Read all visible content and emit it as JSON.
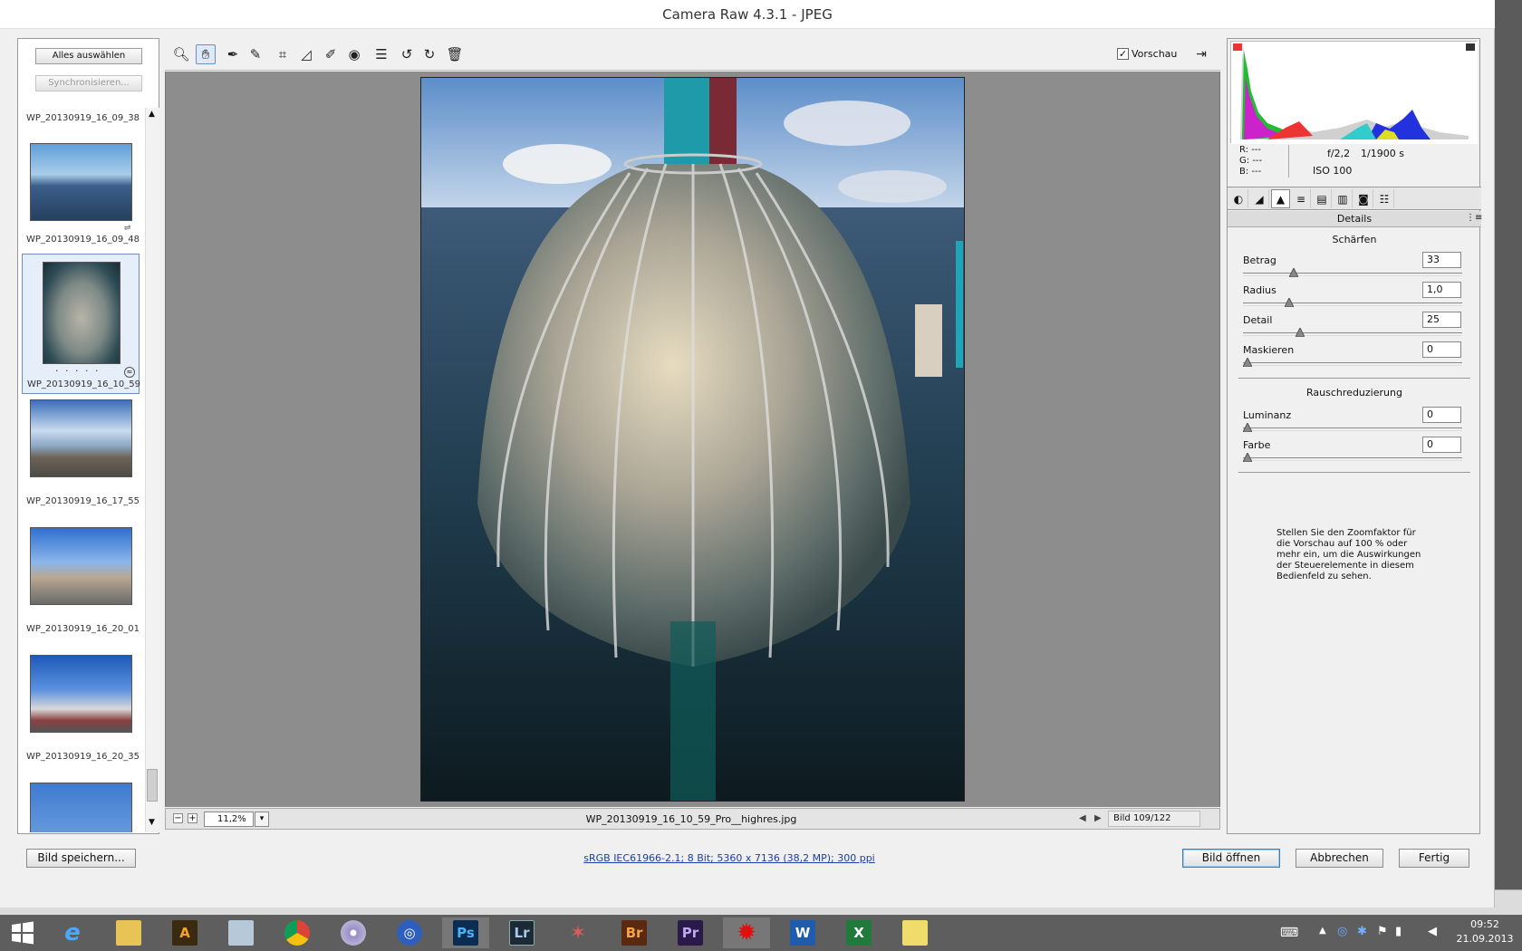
{
  "window": {
    "title": "Camera Raw 4.3.1 - JPEG"
  },
  "filmstrip": {
    "select_all": "Alles auswählen",
    "synchronize": "Synchronisieren...",
    "items": [
      {
        "name": "WP_20130919_16_09_38_..."
      },
      {
        "name": "WP_20130919_16_09_48_..."
      },
      {
        "name": "WP_20130919_16_10_59_...",
        "selected": true
      },
      {
        "name": "WP_20130919_16_17_55_..."
      },
      {
        "name": "WP_20130919_16_20_01_..."
      },
      {
        "name": "WP_20130919_16_20_35_..."
      }
    ],
    "rating_dots": "· · · · ·"
  },
  "toolbar": {
    "tools": [
      "zoom-tool",
      "hand-tool",
      "white-balance-tool",
      "color-sampler-tool",
      "crop-tool",
      "straighten-tool",
      "retouch-tool",
      "red-eye-tool",
      "preferences-tool",
      "rotate-left-tool",
      "rotate-right-tool",
      "delete-tool"
    ],
    "preview_label": "Vorschau",
    "preview_checked": true
  },
  "status": {
    "zoom_minus": "−",
    "zoom_plus": "+",
    "zoom": "11,2%",
    "filename": "WP_20130919_16_10_59_Pro__highres.jpg",
    "image_counter": "Bild 109/122"
  },
  "info": {
    "r_label": "R:",
    "r_value": "---",
    "g_label": "G:",
    "g_value": "---",
    "b_label": "B:",
    "b_value": "---",
    "aperture": "f/2,2",
    "shutter": "1/1900 s",
    "iso": "ISO 100"
  },
  "panel": {
    "title": "Details",
    "sharpen_title": "Schärfen",
    "sharpen": [
      {
        "label": "Betrag",
        "value": "33",
        "pos": 0.22
      },
      {
        "label": "Radius",
        "value": "1,0",
        "pos": 0.2
      },
      {
        "label": "Detail",
        "value": "25",
        "pos": 0.25
      },
      {
        "label": "Maskieren",
        "value": "0",
        "pos": 0.0
      }
    ],
    "noise_title": "Rauschreduzierung",
    "noise": [
      {
        "label": "Luminanz",
        "value": "0",
        "pos": 0.0
      },
      {
        "label": "Farbe",
        "value": "0",
        "pos": 0.0
      }
    ],
    "hint": "Stellen Sie den Zoomfaktor für die Vorschau auf 100 % oder mehr ein, um die Auswirkungen der Steuerelemente in diesem Bedienfeld zu sehen."
  },
  "footer": {
    "save": "Bild speichern...",
    "workflow": "sRGB IEC61966-2.1; 8 Bit; 5360 x 7136 (38,2 MP); 300 ppi",
    "open": "Bild öffnen",
    "cancel": "Abbrechen",
    "done": "Fertig"
  },
  "taskbar": {
    "apps": [
      "start",
      "internet-explorer",
      "file-explorer",
      "illustrator-a",
      "photo-viewer",
      "chrome",
      "dvd-player",
      "app-round",
      "photoshop",
      "lightroom",
      "app-star",
      "bridge",
      "premiere",
      "app-splash",
      "word",
      "excel",
      "app-folder"
    ],
    "ps_label": "Ps",
    "lr_label": "Lr",
    "br_label": "Br",
    "pr_label": "Pr",
    "time": "09:52",
    "date": "21.09.2013"
  }
}
